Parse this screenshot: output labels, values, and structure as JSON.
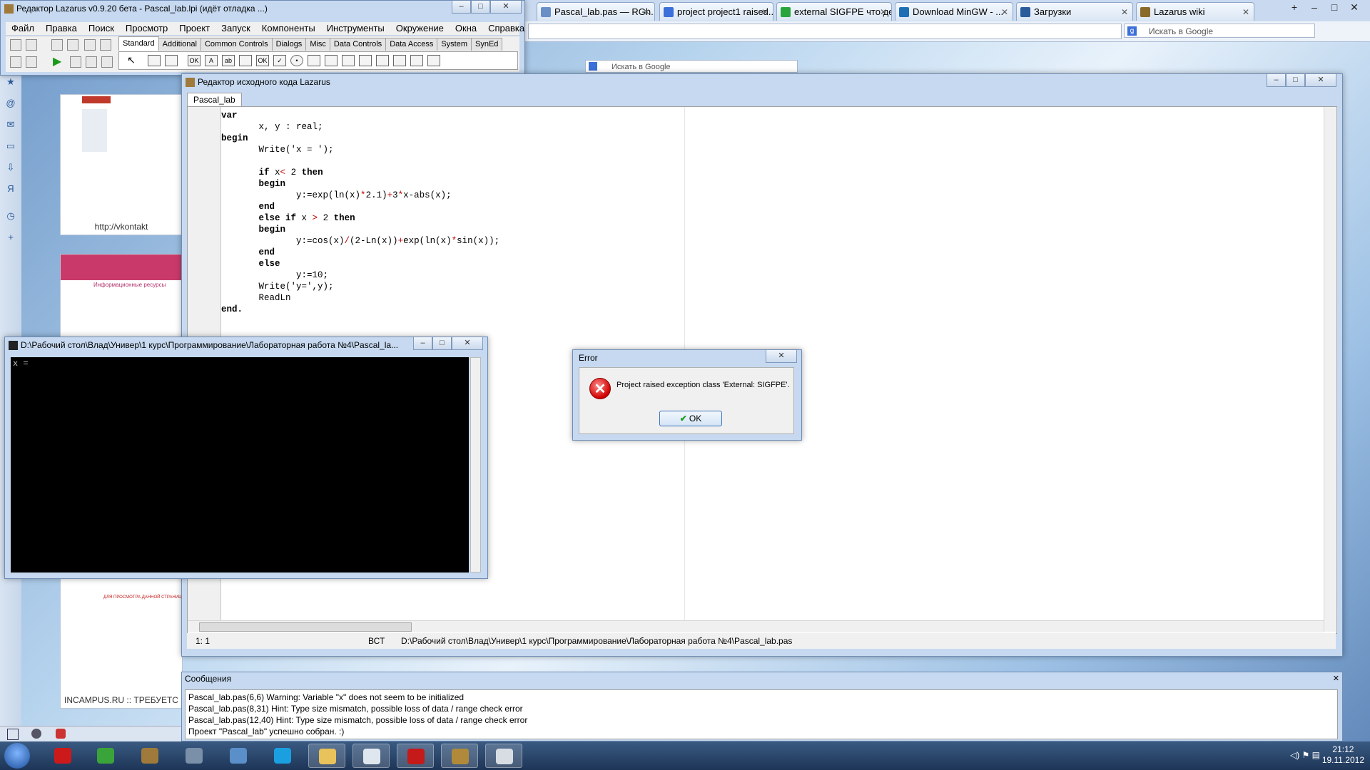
{
  "browser": {
    "tabs": [
      {
        "label": "Pascal_lab.pas — RGh...",
        "icon": "page-icon",
        "color": "#6a8fc7"
      },
      {
        "label": "project project1 raised...",
        "icon": "google-icon",
        "color": "#3b6fd9"
      },
      {
        "label": "external SIGFPE что де...",
        "icon": "google-icon",
        "color": "#2aa53b"
      },
      {
        "label": "Download MinGW - ...",
        "icon": "sourceforge-icon",
        "color": "#1f6fb5"
      },
      {
        "label": "Загрузки",
        "icon": "download-icon",
        "color": "#2a5b9a"
      },
      {
        "label": "Lazarus wiki",
        "icon": "lazarus-icon",
        "color": "#8a6a2a"
      }
    ],
    "search_placeholder": "Искать в Google",
    "search_placeholder2": "Искать в Google",
    "thumb1_caption": "http://vkontakt",
    "thumb2_heading": "Информационные ресурсы",
    "thumb3_caption": "INCAMPUS.RU :: ТРЕБУЕТС",
    "thumb_red_text": "ДЛЯ ПРОСМОТРА ДАННОЙ СТРАНИЦЫ ТРЕБУЕ"
  },
  "lazarus_main": {
    "title": "Редактор Lazarus v0.9.20 бета - Pascal_lab.lpi (идёт отладка ...)",
    "menu": [
      "Файл",
      "Правка",
      "Поиск",
      "Просмотр",
      "Проект",
      "Запуск",
      "Компоненты",
      "Инструменты",
      "Окружение",
      "Окна",
      "Справка"
    ],
    "palette_tabs": [
      "Standard",
      "Additional",
      "Common Controls",
      "Dialogs",
      "Misc",
      "Data Controls",
      "Data Access",
      "System",
      "SynEd"
    ],
    "palette_active": "Standard"
  },
  "source_editor": {
    "title": "Редактор исходного кода Lazarus",
    "tab": "Pascal_lab",
    "status_pos": "1:  1",
    "status_mode": "ВСТ",
    "status_path": "D:\\Рабочий стол\\Влад\\Универ\\1 курс\\Программирование\\Лабораторная работа №4\\Pascal_lab.pas"
  },
  "code_lines": [
    [
      {
        "t": "var",
        "c": "kw"
      }
    ],
    [
      {
        "t": "       x, y : real;",
        "c": ""
      }
    ],
    [
      {
        "t": "begin",
        "c": "kw"
      }
    ],
    [
      {
        "t": "       Write(",
        "c": ""
      },
      {
        "t": "'x = '",
        "c": ""
      },
      {
        "t": ");",
        "c": ""
      }
    ],
    [
      {
        "t": "",
        "c": ""
      }
    ],
    [
      {
        "t": "       ",
        "c": ""
      },
      {
        "t": "if",
        "c": "kw"
      },
      {
        "t": " x",
        "c": ""
      },
      {
        "t": "<",
        "c": "sym"
      },
      {
        "t": " 2 ",
        "c": ""
      },
      {
        "t": "then",
        "c": "kw"
      }
    ],
    [
      {
        "t": "       ",
        "c": ""
      },
      {
        "t": "begin",
        "c": "kw"
      }
    ],
    [
      {
        "t": "              y:=exp(ln(x)",
        "c": ""
      },
      {
        "t": "*",
        "c": "sym"
      },
      {
        "t": "2.1)",
        "c": ""
      },
      {
        "t": "+",
        "c": "sym"
      },
      {
        "t": "3",
        "c": ""
      },
      {
        "t": "*",
        "c": "sym"
      },
      {
        "t": "x-abs(x);",
        "c": ""
      }
    ],
    [
      {
        "t": "       ",
        "c": ""
      },
      {
        "t": "end",
        "c": "kw"
      }
    ],
    [
      {
        "t": "       ",
        "c": ""
      },
      {
        "t": "else if",
        "c": "kw"
      },
      {
        "t": " x ",
        "c": ""
      },
      {
        "t": ">",
        "c": "sym"
      },
      {
        "t": " 2 ",
        "c": ""
      },
      {
        "t": "then",
        "c": "kw"
      }
    ],
    [
      {
        "t": "       ",
        "c": ""
      },
      {
        "t": "begin",
        "c": "kw"
      }
    ],
    [
      {
        "t": "              y:=cos(x)",
        "c": ""
      },
      {
        "t": "/",
        "c": "sym"
      },
      {
        "t": "(2-Ln(x))",
        "c": ""
      },
      {
        "t": "+",
        "c": "sym"
      },
      {
        "t": "exp(ln(x)",
        "c": ""
      },
      {
        "t": "*",
        "c": "sym"
      },
      {
        "t": "sin(x));",
        "c": ""
      }
    ],
    [
      {
        "t": "       ",
        "c": ""
      },
      {
        "t": "end",
        "c": "kw"
      }
    ],
    [
      {
        "t": "       ",
        "c": ""
      },
      {
        "t": "else",
        "c": "kw"
      }
    ],
    [
      {
        "t": "              y:=10;",
        "c": ""
      }
    ],
    [
      {
        "t": "       Write(",
        "c": ""
      },
      {
        "t": "'y='",
        "c": ""
      },
      {
        "t": ",y);",
        "c": ""
      }
    ],
    [
      {
        "t": "       ReadLn",
        "c": ""
      }
    ],
    [
      {
        "t": "end.",
        "c": "kw"
      }
    ]
  ],
  "messages": {
    "title": "Сообщения",
    "lines": [
      "Pascal_lab.pas(6,6) Warning: Variable \"x\" does not seem to be initialized",
      "Pascal_lab.pas(8,31) Hint: Type size mismatch, possible loss of data / range check error",
      "Pascal_lab.pas(12,40) Hint: Type size mismatch, possible loss of data / range check error",
      "Проект \"Pascal_lab\" успешно собран. :)"
    ]
  },
  "console": {
    "title": "D:\\Рабочий стол\\Влад\\Универ\\1 курс\\Программирование\\Лабораторная работа №4\\Pascal_la...",
    "output": "x ="
  },
  "error_dialog": {
    "title": "Error",
    "message": "Project  raised exception class 'External: SIGFPE'.",
    "ok_label": "OK"
  },
  "taskbar": {
    "time": "21:12",
    "date": "19.11.2012",
    "items": [
      {
        "icon": "opera-icon",
        "color": "#cc1a1a"
      },
      {
        "icon": "chrome-icon",
        "color": "#3aa43a"
      },
      {
        "icon": "lazarus-icon",
        "color": "#a07a3a"
      },
      {
        "icon": "calculator-icon",
        "color": "#7a8fa8"
      },
      {
        "icon": "feather-icon",
        "color": "#5b8fc9"
      },
      {
        "icon": "skype-icon",
        "color": "#1aa0e0"
      },
      {
        "icon": "folder-icon",
        "color": "#e8c25a"
      },
      {
        "icon": "phone-icon",
        "color": "#dfe6ee"
      },
      {
        "icon": "kaspersky-icon",
        "color": "#c41a1a"
      },
      {
        "icon": "lazarus-icon",
        "color": "#b08a3a"
      },
      {
        "icon": "console-icon",
        "color": "#d8dde4"
      }
    ]
  },
  "colors": {
    "keyword": "#000000",
    "symbol": "#c00000",
    "frame": "#c6d9f0",
    "error_red": "#d00000"
  }
}
